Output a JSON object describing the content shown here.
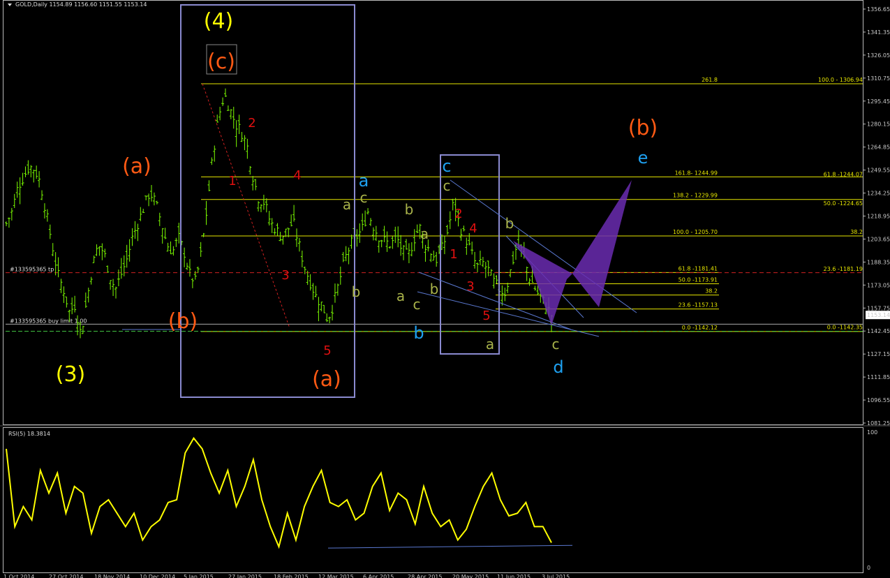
{
  "header": {
    "symbol": "GOLD,Daily",
    "ohlc": "1154.89 1156.60 1151.55 1153.14",
    "price_tag": "1153.14"
  },
  "rsi_header": "RSI(5) 18.3814",
  "orders": {
    "tp_label": "#133595365 tp",
    "buy_label": "#133595365 buy limit 1.00"
  },
  "x_dates": [
    "1 Oct 2014",
    "27 Oct 2014",
    "18 Nov 2014",
    "10 Dec 2014",
    "5 Jan 2015",
    "27 Jan 2015",
    "18 Feb 2015",
    "12 Mar 2015",
    "6 Apr 2015",
    "28 Apr 2015",
    "20 May 2015",
    "11 Jun 2015",
    "3 Jul 2015"
  ],
  "y_ticks": [
    "1356.65",
    "1341.35",
    "1326.05",
    "1310.75",
    "1295.45",
    "1280.15",
    "1264.85",
    "1249.55",
    "1234.25",
    "1218.95",
    "1203.65",
    "1188.35",
    "1173.05",
    "1157.75",
    "1142.45",
    "1127.15",
    "1111.85",
    "1096.55",
    "1081.25"
  ],
  "rsi_ticks": [
    "100",
    "0"
  ],
  "fib_labels": {
    "f2618": "261.8",
    "f100a": "100.0 - 1306.94",
    "f1618": "161.8- 1244.99",
    "f618a": "61.8 -1244.07",
    "f1382": "138.2 - 1229.99",
    "f50a": "50.0 -1224.65",
    "f100b": "100.0 - 1205.70",
    "f382a": "38.2",
    "f618b": "61.8 -1181.41",
    "f236a": "23.6 -1181.19",
    "f50b": "50.0 -1173.91",
    "f382b": "38.2",
    "f236b": "23.6 -1157.13",
    "f0a": "0.0 -1142.12",
    "f0b": "0.0 -1142.35"
  },
  "waves": {
    "w4": "(4)",
    "c_top": "(c)",
    "a_left": "(a)",
    "b_left": "(b)",
    "w3": "(3)",
    "a_mid": "(a)",
    "b_right": "(b)",
    "r1": "1",
    "r2": "2",
    "r3": "3",
    "r4": "4",
    "r5": "5",
    "r1b": "1",
    "r2b": "2",
    "r3b": "3",
    "r4b": "4",
    "r5b": "5",
    "blue_a": "a",
    "blue_b": "b",
    "blue_c": "c",
    "blue_d": "d",
    "blue_e": "e",
    "g_a1": "a",
    "g_c1": "c",
    "g_b1": "b",
    "g_b2": "b",
    "g_a2": "a",
    "g_a3": "a",
    "g_c2": "c",
    "g_b3": "b",
    "g_c3": "c",
    "g_a4": "a",
    "g_b4": "b",
    "g_c4": "c"
  },
  "colors": {
    "candle": "#7cfc00",
    "rsi": "#ffff00",
    "fib": "#e6e600",
    "orange": "#ff5a14",
    "blue": "#1ea0f0",
    "frame": "#8a8ad0",
    "purple": "#6a2bb0"
  },
  "chart_data": {
    "type": "candlestick",
    "symbol": "GOLD,Daily",
    "y_range": [
      1077.42,
      1362.0
    ],
    "x_dates": [
      "1 Oct 2014",
      "27 Oct 2014",
      "18 Nov 2014",
      "10 Dec 2014",
      "5 Jan 2015",
      "27 Jan 2015",
      "18 Feb 2015",
      "12 Mar 2015",
      "6 Apr 2015",
      "28 Apr 2015",
      "20 May 2015",
      "11 Jun 2015",
      "3 Jul 2015"
    ],
    "close_path": [
      1214,
      1222,
      1238,
      1245,
      1252,
      1250,
      1240,
      1220,
      1200,
      1180,
      1170,
      1155,
      1160,
      1140,
      1162,
      1185,
      1200,
      1195,
      1180,
      1170,
      1180,
      1190,
      1205,
      1215,
      1225,
      1235,
      1228,
      1215,
      1200,
      1195,
      1205,
      1195,
      1180,
      1175,
      1195,
      1225,
      1260,
      1285,
      1300,
      1290,
      1280,
      1275,
      1265,
      1245,
      1230,
      1228,
      1215,
      1210,
      1205,
      1210,
      1215,
      1200,
      1185,
      1175,
      1165,
      1160,
      1150,
      1160,
      1175,
      1190,
      1200,
      1205,
      1210,
      1222,
      1212,
      1205,
      1202,
      1200,
      1205,
      1196,
      1192,
      1203,
      1212,
      1200,
      1195,
      1190,
      1198,
      1210,
      1229,
      1212,
      1205,
      1195,
      1185,
      1188,
      1183,
      1175,
      1170,
      1168,
      1185,
      1200,
      1195,
      1180,
      1172,
      1165,
      1160,
      1153
    ],
    "rsi": [
      88,
      30,
      45,
      35,
      72,
      55,
      70,
      40,
      60,
      55,
      25,
      45,
      50,
      40,
      30,
      40,
      20,
      30,
      35,
      48,
      50,
      85,
      96,
      88,
      70,
      55,
      72,
      45,
      60,
      80,
      50,
      30,
      15,
      40,
      20,
      45,
      60,
      72,
      48,
      45,
      50,
      35,
      40,
      60,
      70,
      42,
      55,
      50,
      32,
      60,
      40,
      30,
      35,
      20,
      28,
      45,
      60,
      70,
      50,
      38,
      40,
      48,
      30,
      30,
      18
    ],
    "rsi_period": 5,
    "rsi_last": 18.3814,
    "fib_levels": [
      {
        "label": "261.8",
        "value": 1306.94
      },
      {
        "label": "161.8",
        "value": 1244.99
      },
      {
        "label": "138.2",
        "value": 1229.99
      },
      {
        "label": "100.0",
        "value": 1205.7
      },
      {
        "label": "61.8",
        "value": 1181.41
      },
      {
        "label": "50.0",
        "value": 1173.91
      },
      {
        "label": "38.2",
        "value": 1166.4
      },
      {
        "label": "23.6",
        "value": 1157.13
      },
      {
        "label": "0.0",
        "value": 1142.12
      }
    ],
    "orders": [
      {
        "label": "#133595365 tp",
        "value": 1181.3
      },
      {
        "label": "#133595365 buy limit 1.00",
        "value": 1142.3
      }
    ]
  }
}
